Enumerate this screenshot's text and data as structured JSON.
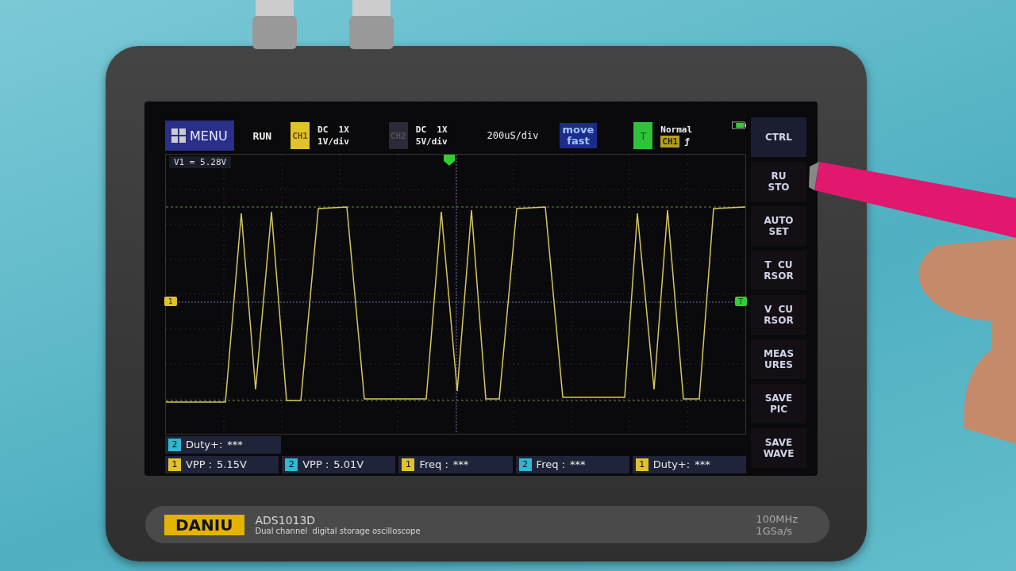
{
  "top_bar": {
    "menu": "MENU",
    "run_state": "RUN",
    "channels": [
      {
        "badge": "CH1",
        "coupling": "DC  1X",
        "scale": "1V/div",
        "active": true,
        "color": "#e0c22a"
      },
      {
        "badge": "CH2",
        "coupling": "DC  1X",
        "scale": "5V/div",
        "active": false
      }
    ],
    "timebase": "200uS/div",
    "move_mode": [
      "move",
      "fast"
    ],
    "trigger": {
      "badge": "T",
      "mode": "Normal",
      "source": "CH1",
      "edge": "ƒ"
    }
  },
  "cursor_readout": "V1 = 5.28V",
  "markers": {
    "channel": "1",
    "trigger": "T"
  },
  "side_menu": [
    {
      "lines": [
        "CTRL"
      ],
      "selected": true
    },
    {
      "lines": [
        "RU",
        "STO"
      ],
      "selected": false
    },
    {
      "lines": [
        "AUTO",
        "SET"
      ],
      "selected": false
    },
    {
      "lines": [
        "T  CU",
        "RSOR"
      ],
      "selected": false
    },
    {
      "lines": [
        "V  CU",
        "RSOR"
      ],
      "selected": false
    },
    {
      "lines": [
        "MEAS",
        "URES"
      ],
      "selected": false
    },
    {
      "lines": [
        "SAVE",
        "PIC"
      ],
      "selected": false
    },
    {
      "lines": [
        "SAVE",
        "WAVE"
      ],
      "selected": false
    }
  ],
  "measurements": [
    [
      {
        "channel": "2",
        "label": "Duty+:",
        "value": "***",
        "color": "#2fb8d0"
      }
    ],
    [
      {
        "channel": "1",
        "label": "VPP :",
        "value": "5.15V",
        "color": "#e0c22a"
      },
      {
        "channel": "2",
        "label": "VPP :",
        "value": "5.01V",
        "color": "#2fb8d0"
      },
      {
        "channel": "1",
        "label": "Freq :",
        "value": "***",
        "color": "#e0c22a"
      },
      {
        "channel": "2",
        "label": "Freq :",
        "value": "***",
        "color": "#2fb8d0"
      },
      {
        "channel": "1",
        "label": "Duty+:",
        "value": "***",
        "color": "#e0c22a"
      }
    ]
  ],
  "label_strip": {
    "brand": "DANIU",
    "model": "ADS1013D",
    "description": "Dual channel  digital storage oscilloscope",
    "specs": [
      "100MHz",
      "1GSa/s"
    ]
  }
}
